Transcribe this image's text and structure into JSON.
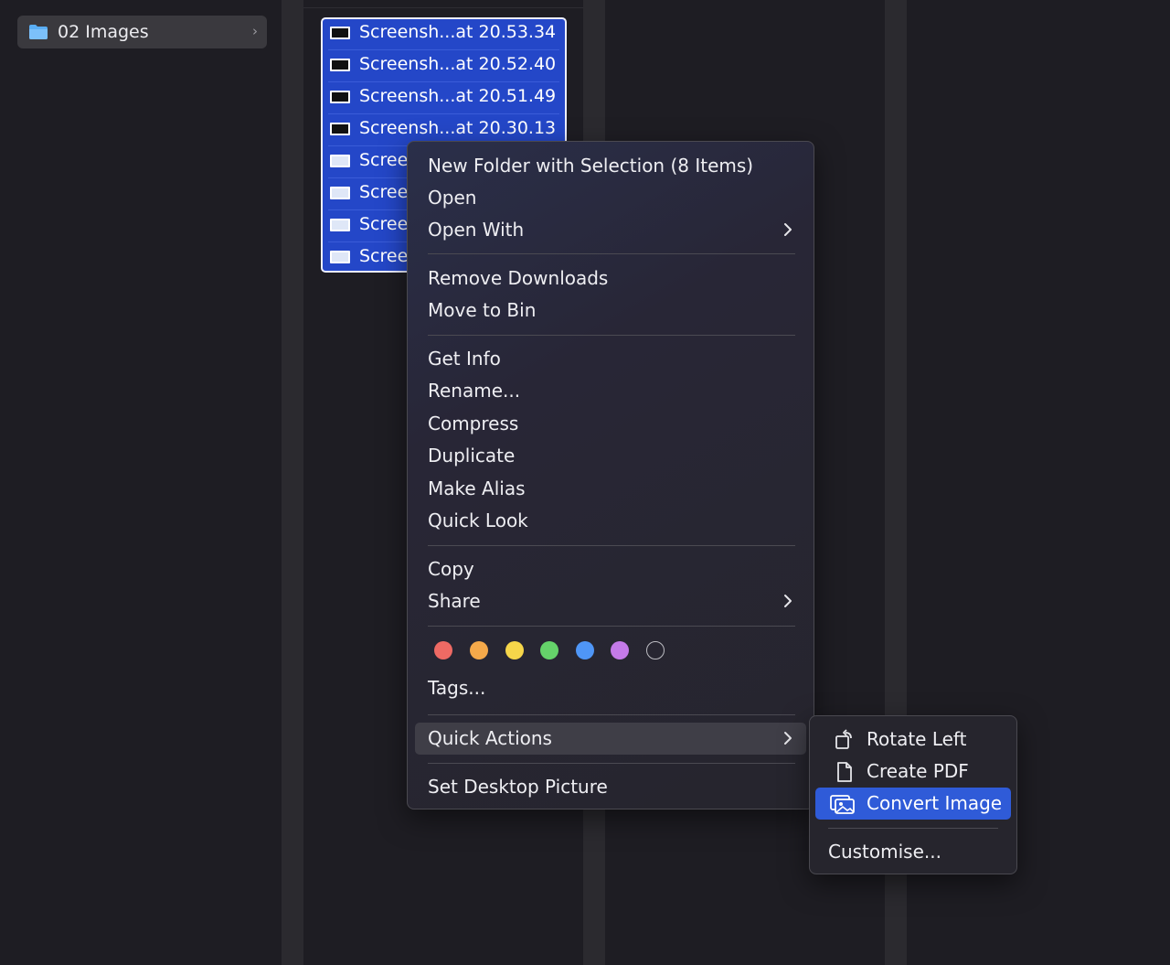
{
  "sidebar": {
    "folder": {
      "label": "02 Images",
      "icon": "folder-icon"
    }
  },
  "files": [
    {
      "name": "Screensh...at 20.53.34",
      "thumb": "dark"
    },
    {
      "name": "Screensh...at 20.52.40",
      "thumb": "dark"
    },
    {
      "name": "Screensh...at 20.51.49",
      "thumb": "dark"
    },
    {
      "name": "Screensh...at 20.30.13",
      "thumb": "dark"
    },
    {
      "name": "Scree",
      "thumb": "light"
    },
    {
      "name": "Scree",
      "thumb": "light"
    },
    {
      "name": "Scree",
      "thumb": "light"
    },
    {
      "name": "Scree",
      "thumb": "light"
    }
  ],
  "context_menu": {
    "new_folder": "New Folder with Selection (8 Items)",
    "open": "Open",
    "open_with": "Open With",
    "remove_downloads": "Remove Downloads",
    "move_to_bin": "Move to Bin",
    "get_info": "Get Info",
    "rename": "Rename...",
    "compress": "Compress",
    "duplicate": "Duplicate",
    "make_alias": "Make Alias",
    "quick_look": "Quick Look",
    "copy": "Copy",
    "share": "Share",
    "tags": "Tags...",
    "quick_actions": "Quick Actions",
    "set_desktop": "Set Desktop Picture",
    "tag_colors": [
      {
        "name": "red",
        "color": "#ee6a64"
      },
      {
        "name": "orange",
        "color": "#f5a94a"
      },
      {
        "name": "yellow",
        "color": "#f6d64a"
      },
      {
        "name": "green",
        "color": "#65d36a"
      },
      {
        "name": "blue",
        "color": "#4f96f7"
      },
      {
        "name": "purple",
        "color": "#c47ae8"
      },
      {
        "name": "none",
        "color": "transparent"
      }
    ]
  },
  "submenu": {
    "rotate_left": "Rotate Left",
    "create_pdf": "Create PDF",
    "convert_image": "Convert Image",
    "customise": "Customise..."
  },
  "colors": {
    "selection": "#2447c8",
    "active_item": "#2f5bd8",
    "background": "#1e1d23"
  }
}
